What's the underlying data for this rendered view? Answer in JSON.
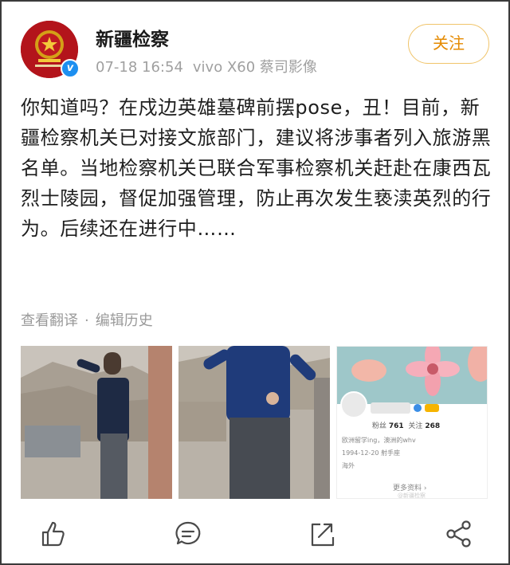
{
  "account": {
    "name": "新疆检察",
    "verified_mark": "v"
  },
  "post": {
    "date": "07-18 16:54",
    "device": "vivo X60 蔡司影像",
    "text": "你知道吗？在戍边英雄墓碑前摆pose，丑！目前，新疆检察机关已对接文旅部门，建议将涉事者列入旅游黑名单。当地检察机关已联合军事检察机关赶赴在康西瓦烈士陵园，督促加强管理，防止再次发生亵渎英烈的行为。后续还在进行中……",
    "view_translation": "查看翻译",
    "separator": "·",
    "edit_history": "编辑历史"
  },
  "header": {
    "follow_label": "关注"
  },
  "images": {
    "profile_card": {
      "fans_label": "粉丝",
      "fans_count": "761",
      "follow_label": "关注",
      "follow_count": "268",
      "bio_line": "欧洲留学ing，澳洲的whv",
      "birth_line": "1994-12-20 射手座",
      "location_line": "海外",
      "more_label": "更多资料 ›",
      "watermark": "@新疆检察"
    }
  },
  "actions": [
    {
      "name": "like",
      "icon": "thumb-up-icon"
    },
    {
      "name": "comment",
      "icon": "comment-icon"
    },
    {
      "name": "repost",
      "icon": "repost-icon"
    },
    {
      "name": "share",
      "icon": "share-icon"
    }
  ],
  "colors": {
    "follow_text": "#e58a00",
    "follow_border": "#f0c46a",
    "meta_gray": "#a0a0a0",
    "verified_blue": "#1d8ff0"
  }
}
